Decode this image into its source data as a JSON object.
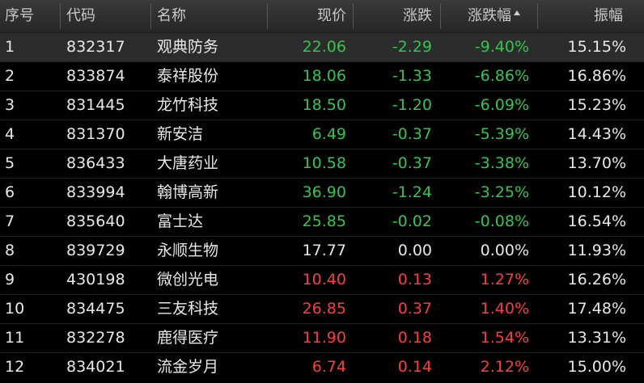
{
  "header": {
    "idx": "序号",
    "code": "代码",
    "name": "名称",
    "price": "现价",
    "change": "涨跌",
    "pct": "涨跌幅",
    "amplitude": "振幅"
  },
  "colors": {
    "up": "#ff3b3b",
    "down": "#2ec84a",
    "flat": "#e8e8e8",
    "selected_row": "#2c2c2c"
  },
  "rows": [
    {
      "idx": "1",
      "code": "832317",
      "name": "观典防务",
      "price": "22.06",
      "change": "-2.29",
      "pct": "-9.40%",
      "amplitude": "15.15%",
      "dir": "down"
    },
    {
      "idx": "2",
      "code": "833874",
      "name": "泰祥股份",
      "price": "18.06",
      "change": "-1.33",
      "pct": "-6.86%",
      "amplitude": "16.86%",
      "dir": "down"
    },
    {
      "idx": "3",
      "code": "831445",
      "name": "龙竹科技",
      "price": "18.50",
      "change": "-1.20",
      "pct": "-6.09%",
      "amplitude": "15.23%",
      "dir": "down"
    },
    {
      "idx": "4",
      "code": "831370",
      "name": "新安洁",
      "price": "6.49",
      "change": "-0.37",
      "pct": "-5.39%",
      "amplitude": "14.43%",
      "dir": "down"
    },
    {
      "idx": "5",
      "code": "836433",
      "name": "大唐药业",
      "price": "10.58",
      "change": "-0.37",
      "pct": "-3.38%",
      "amplitude": "13.70%",
      "dir": "down"
    },
    {
      "idx": "6",
      "code": "833994",
      "name": "翰博高新",
      "price": "36.90",
      "change": "-1.24",
      "pct": "-3.25%",
      "amplitude": "10.12%",
      "dir": "down"
    },
    {
      "idx": "7",
      "code": "835640",
      "name": "富士达",
      "price": "25.85",
      "change": "-0.02",
      "pct": "-0.08%",
      "amplitude": "16.54%",
      "dir": "down"
    },
    {
      "idx": "8",
      "code": "839729",
      "name": "永顺生物",
      "price": "17.77",
      "change": "0.00",
      "pct": "0.00%",
      "amplitude": "11.93%",
      "dir": "flat"
    },
    {
      "idx": "9",
      "code": "430198",
      "name": "微创光电",
      "price": "10.40",
      "change": "0.13",
      "pct": "1.27%",
      "amplitude": "16.26%",
      "dir": "up"
    },
    {
      "idx": "10",
      "code": "834475",
      "name": "三友科技",
      "price": "26.85",
      "change": "0.37",
      "pct": "1.40%",
      "amplitude": "17.48%",
      "dir": "up"
    },
    {
      "idx": "11",
      "code": "832278",
      "name": "鹿得医疗",
      "price": "11.90",
      "change": "0.18",
      "pct": "1.54%",
      "amplitude": "13.31%",
      "dir": "up"
    },
    {
      "idx": "12",
      "code": "834021",
      "name": "流金岁月",
      "price": "6.74",
      "change": "0.14",
      "pct": "2.12%",
      "amplitude": "15.00%",
      "dir": "up"
    }
  ],
  "selected_row": 0
}
